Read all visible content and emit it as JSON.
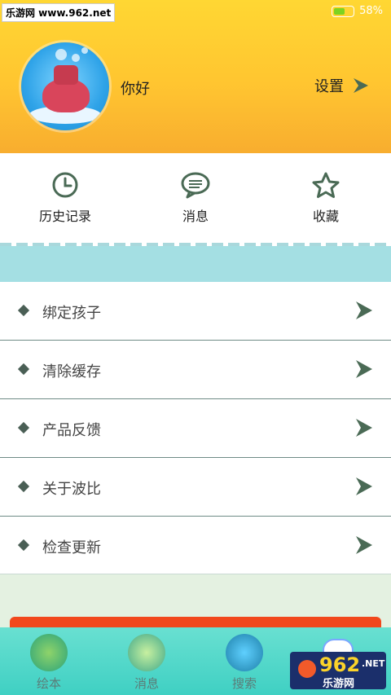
{
  "status": {
    "watermark": "乐游网 www.962.net",
    "battery": "58%",
    "battery_level": 0.58
  },
  "profile": {
    "greeting": "你好",
    "settings_label": "设置"
  },
  "quick_actions": [
    {
      "label": "历史记录",
      "icon": "clock-icon"
    },
    {
      "label": "消息",
      "icon": "chat-icon"
    },
    {
      "label": "收藏",
      "icon": "star-icon"
    }
  ],
  "menu": [
    {
      "label": "绑定孩子"
    },
    {
      "label": "清除缓存"
    },
    {
      "label": "产品反馈"
    },
    {
      "label": "关于波比"
    },
    {
      "label": "检查更新"
    }
  ],
  "tabbar": [
    {
      "label": "绘本",
      "icon": "book-icon"
    },
    {
      "label": "消息",
      "icon": "envelope-icon"
    },
    {
      "label": "搜索",
      "icon": "search-icon"
    },
    {
      "label": "",
      "icon": "robot-icon"
    }
  ],
  "logo": {
    "number": "962",
    "suffix": ".NET",
    "text": "乐游网"
  },
  "colors": {
    "accent": "#4a6a55",
    "header": "#ffd733",
    "tabbar": "#3fd0c3",
    "orange": "#f1481c"
  }
}
